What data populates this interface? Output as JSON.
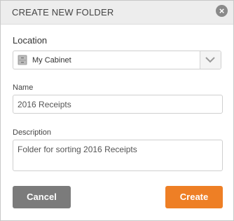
{
  "dialog": {
    "title": "CREATE NEW FOLDER",
    "close_icon": "close-circle-icon"
  },
  "location": {
    "label": "Location",
    "selected": "My Cabinet",
    "icon": "cabinet-icon",
    "dropdown_icon": "chevron-down-icon"
  },
  "name": {
    "label": "Name",
    "value": "2016 Receipts"
  },
  "description": {
    "label": "Description",
    "value": "Folder for sorting 2016 Receipts"
  },
  "buttons": {
    "cancel": "Cancel",
    "create": "Create"
  },
  "colors": {
    "primary": "#ee7f25",
    "secondary": "#7b7b7b"
  }
}
